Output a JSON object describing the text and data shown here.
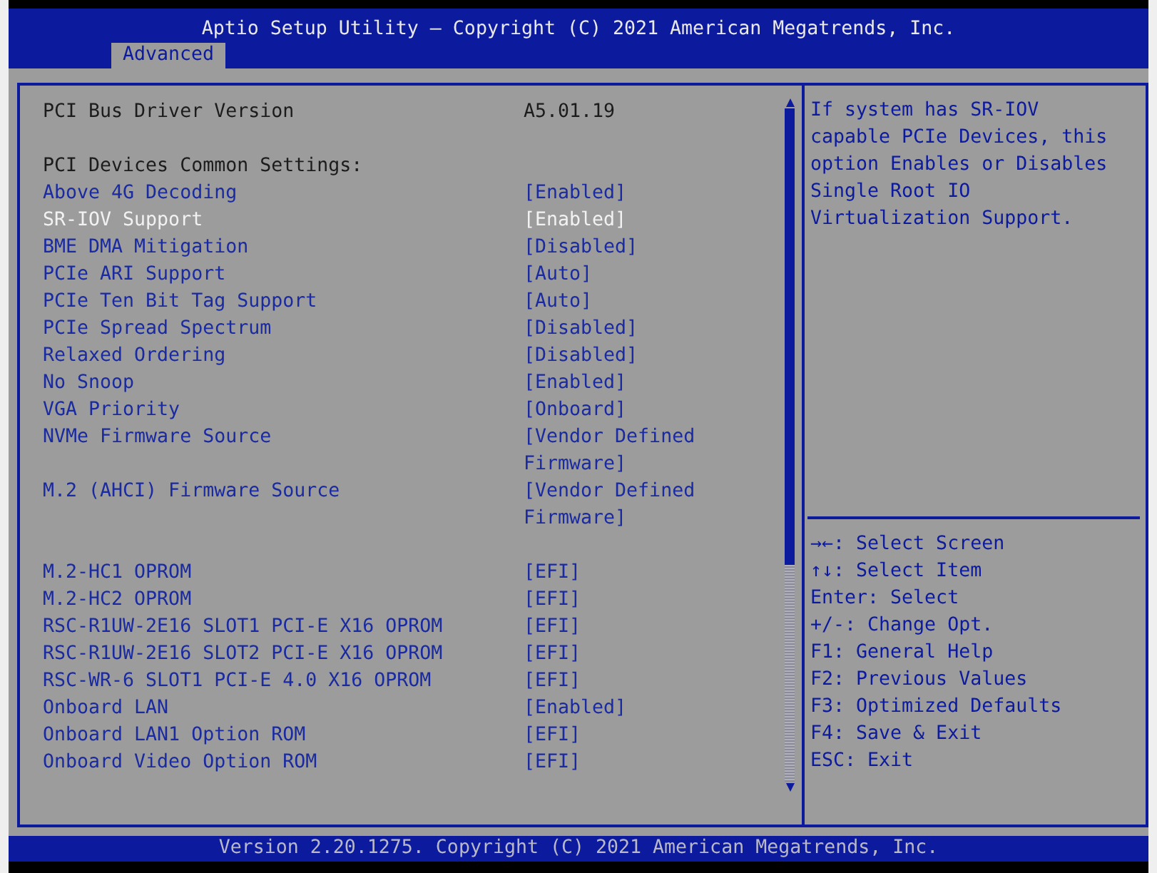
{
  "title": "Aptio Setup Utility – Copyright (C) 2021 American Megatrends, Inc.",
  "tabs": [
    {
      "label": "Advanced",
      "selected": true
    }
  ],
  "rows": [
    {
      "kind": "info",
      "label": "PCI Bus Driver Version",
      "value": "A5.01.19"
    },
    {
      "kind": "spacer"
    },
    {
      "kind": "heading",
      "label": "PCI Devices Common Settings:"
    },
    {
      "kind": "option",
      "label": "Above 4G Decoding",
      "value": "[Enabled]",
      "selected": false
    },
    {
      "kind": "option",
      "label": "SR-IOV Support",
      "value": "[Enabled]",
      "selected": true
    },
    {
      "kind": "option",
      "label": "BME DMA Mitigation",
      "value": "[Disabled]",
      "selected": false
    },
    {
      "kind": "option",
      "label": "PCIe ARI Support",
      "value": "[Auto]",
      "selected": false
    },
    {
      "kind": "option",
      "label": "PCIe Ten Bit Tag Support",
      "value": "[Auto]",
      "selected": false
    },
    {
      "kind": "option",
      "label": "PCIe Spread Spectrum",
      "value": "[Disabled]",
      "selected": false
    },
    {
      "kind": "option",
      "label": "Relaxed Ordering",
      "value": "[Disabled]",
      "selected": false
    },
    {
      "kind": "option",
      "label": "No Snoop",
      "value": "[Enabled]",
      "selected": false
    },
    {
      "kind": "option",
      "label": "VGA Priority",
      "value": "[Onboard]",
      "selected": false
    },
    {
      "kind": "option",
      "label": "NVMe Firmware Source",
      "value": "[Vendor Defined Firmware]",
      "selected": false
    },
    {
      "kind": "option",
      "label": "M.2 (AHCI) Firmware Source",
      "value": "[Vendor Defined Firmware]",
      "selected": false
    },
    {
      "kind": "spacer"
    },
    {
      "kind": "option",
      "label": "M.2-HC1 OPROM",
      "value": "[EFI]",
      "selected": false
    },
    {
      "kind": "option",
      "label": "M.2-HC2 OPROM",
      "value": "[EFI]",
      "selected": false
    },
    {
      "kind": "option",
      "label": "RSC-R1UW-2E16 SLOT1 PCI-E X16 OPROM",
      "value": "[EFI]",
      "selected": false
    },
    {
      "kind": "option",
      "label": "RSC-R1UW-2E16 SLOT2 PCI-E X16 OPROM",
      "value": "[EFI]",
      "selected": false
    },
    {
      "kind": "option",
      "label": "RSC-WR-6 SLOT1 PCI-E 4.0 X16 OPROM",
      "value": "[EFI]",
      "selected": false
    },
    {
      "kind": "option",
      "label": "Onboard LAN",
      "value": "[Enabled]",
      "selected": false
    },
    {
      "kind": "option",
      "label": "Onboard LAN1 Option ROM",
      "value": "[EFI]",
      "selected": false
    },
    {
      "kind": "option",
      "label": "Onboard Video Option ROM",
      "value": "[EFI]",
      "selected": false
    }
  ],
  "help": "If system has SR-IOV capable PCIe Devices, this option Enables or Disables Single Root IO Virtualization Support.",
  "keys": [
    "→←: Select Screen",
    "↑↓: Select Item",
    "Enter: Select",
    "+/-: Change Opt.",
    "F1: General Help",
    "F2: Previous Values",
    "F3: Optimized Defaults",
    "F4: Save & Exit",
    "ESC: Exit"
  ],
  "footer": "Version 2.20.1275. Copyright (C) 2021 American Megatrends, Inc."
}
